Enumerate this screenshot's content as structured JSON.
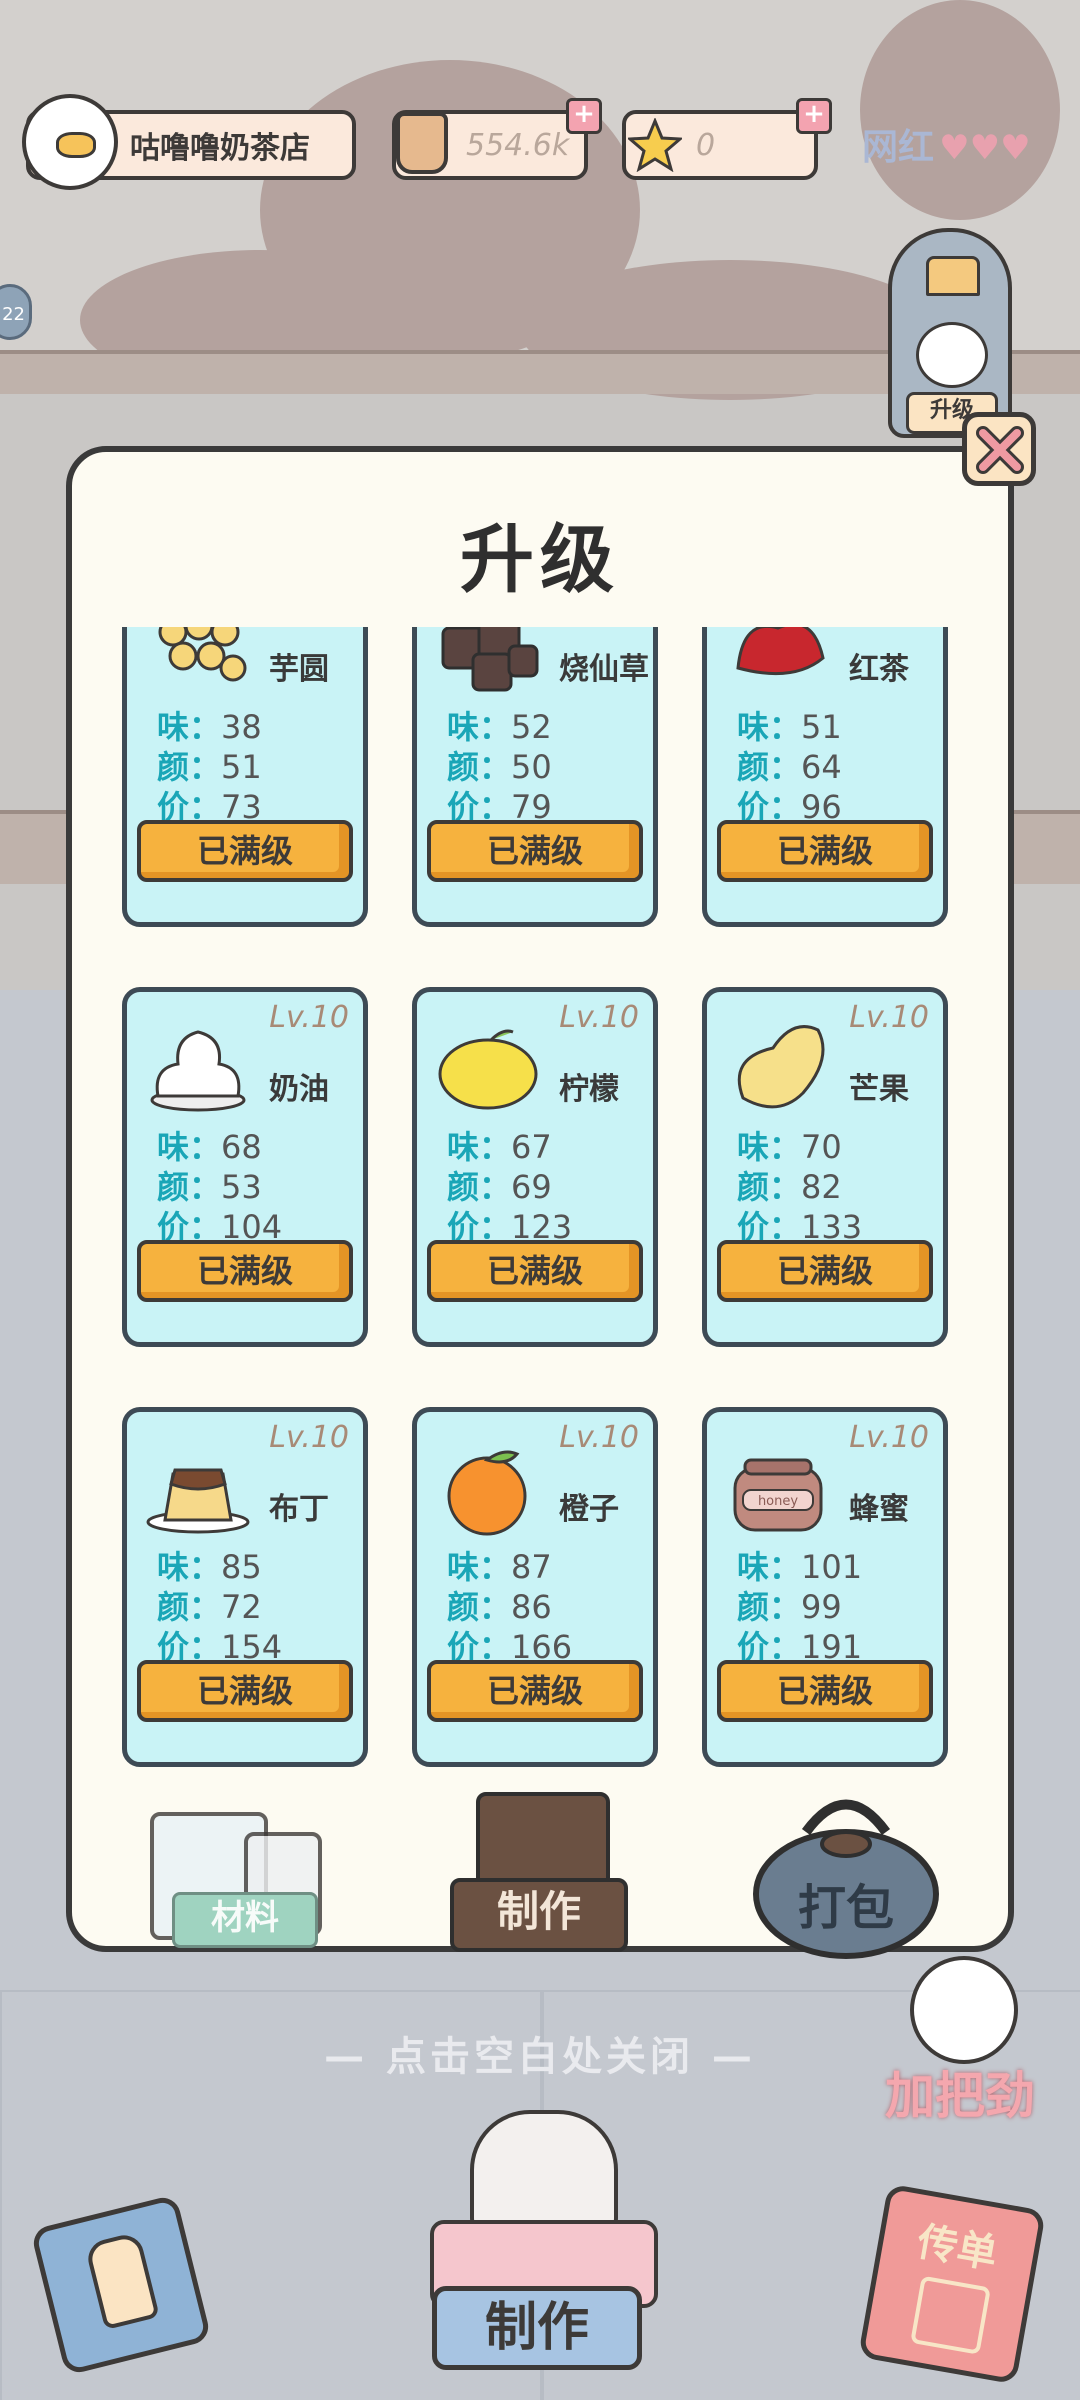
{
  "shop": {
    "name": "咕噜噜奶茶店"
  },
  "currency": {
    "coins": "554.6k",
    "stars": "0"
  },
  "top_right": {
    "label": "网红"
  },
  "side_badge": "22",
  "npc_tag": "升级",
  "modal": {
    "title": "升级"
  },
  "labels": {
    "taste": "味：",
    "look": "颜：",
    "price": "价：",
    "maxed": "已满级"
  },
  "items": [
    {
      "name": "芋圆",
      "level": "",
      "taste": "38",
      "look": "51",
      "price": "73",
      "icon": "taro-ball-icon"
    },
    {
      "name": "烧仙草",
      "level": "",
      "taste": "52",
      "look": "50",
      "price": "79",
      "icon": "grass-jelly-icon"
    },
    {
      "name": "红茶",
      "level": "",
      "taste": "51",
      "look": "64",
      "price": "96",
      "icon": "black-tea-icon"
    },
    {
      "name": "奶油",
      "level": "Lv.10",
      "taste": "68",
      "look": "53",
      "price": "104",
      "icon": "cream-icon"
    },
    {
      "name": "柠檬",
      "level": "Lv.10",
      "taste": "67",
      "look": "69",
      "price": "123",
      "icon": "lemon-icon"
    },
    {
      "name": "芒果",
      "level": "Lv.10",
      "taste": "70",
      "look": "82",
      "price": "133",
      "icon": "mango-icon"
    },
    {
      "name": "布丁",
      "level": "Lv.10",
      "taste": "85",
      "look": "72",
      "price": "154",
      "icon": "pudding-icon"
    },
    {
      "name": "橙子",
      "level": "Lv.10",
      "taste": "87",
      "look": "86",
      "price": "166",
      "icon": "orange-icon"
    },
    {
      "name": "蜂蜜",
      "level": "Lv.10",
      "taste": "101",
      "look": "99",
      "price": "191",
      "icon": "honey-icon",
      "jar_text": "honey"
    },
    {
      "name": "",
      "level": "",
      "taste": "",
      "look": "",
      "price": "",
      "icon": "placeholder"
    },
    {
      "name": "",
      "level": "",
      "taste": "",
      "look": "",
      "price": "",
      "icon": "placeholder"
    },
    {
      "name": "",
      "level": "",
      "taste": "",
      "look": "",
      "price": "",
      "icon": "placeholder"
    }
  ],
  "tabs": {
    "materials": "材料",
    "make": "制作",
    "pack": "打包"
  },
  "hint": "— 点击空白处关闭 —",
  "cheer": "加把劲",
  "bottom": {
    "make": "制作",
    "flyer": "传单"
  },
  "colors": {
    "card_bg": "#c9f3f6",
    "button": "#f6b23e",
    "stat_key": "#1aa6b7",
    "level": "#a88a76"
  }
}
